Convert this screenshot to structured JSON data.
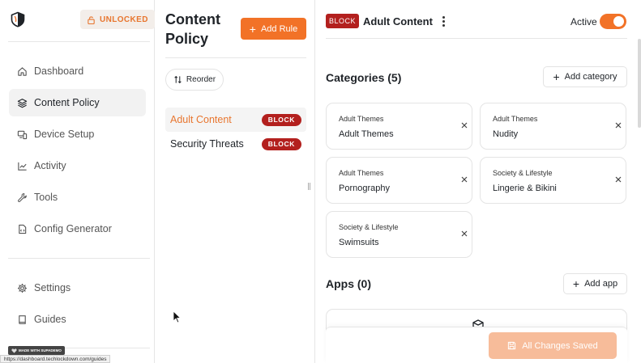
{
  "sidebar": {
    "lock_badge": "UNLOCKED",
    "nav": [
      {
        "label": "Dashboard",
        "icon": "home-icon"
      },
      {
        "label": "Content Policy",
        "icon": "layers-icon"
      },
      {
        "label": "Device Setup",
        "icon": "devices-icon"
      },
      {
        "label": "Activity",
        "icon": "chart-line-icon"
      },
      {
        "label": "Tools",
        "icon": "wrench-icon"
      },
      {
        "label": "Config Generator",
        "icon": "file-code-icon"
      }
    ],
    "bottom_nav": [
      {
        "label": "Settings",
        "icon": "gear-icon"
      },
      {
        "label": "Guides",
        "icon": "book-icon"
      }
    ],
    "made_with": "MADE WITH SUPADEMO",
    "status_url": "https://dashboard.techlockdown.com/guides"
  },
  "rules": {
    "title": "Content Policy",
    "add_label": "Add Rule",
    "reorder_label": "Reorder",
    "items": [
      {
        "name": "Adult Content",
        "action": "BLOCK"
      },
      {
        "name": "Security Threats",
        "action": "BLOCK"
      }
    ]
  },
  "detail": {
    "action_badge": "BLOCK",
    "title": "Adult Content",
    "status_label": "Active",
    "categories_title": "Categories (5)",
    "add_category_label": "Add category",
    "categories": [
      {
        "parent": "Adult Themes",
        "name": "Adult Themes"
      },
      {
        "parent": "Adult Themes",
        "name": "Nudity"
      },
      {
        "parent": "Adult Themes",
        "name": "Pornography"
      },
      {
        "parent": "Society & Lifestyle",
        "name": "Lingerie & Bikini"
      },
      {
        "parent": "Society & Lifestyle",
        "name": "Swimsuits"
      }
    ],
    "apps_title": "Apps (0)",
    "add_app_label": "Add app",
    "save_label": "All Changes Saved"
  },
  "colors": {
    "accent": "#f27227",
    "block": "#b3201e",
    "save_disabled": "#f7bc9a"
  }
}
